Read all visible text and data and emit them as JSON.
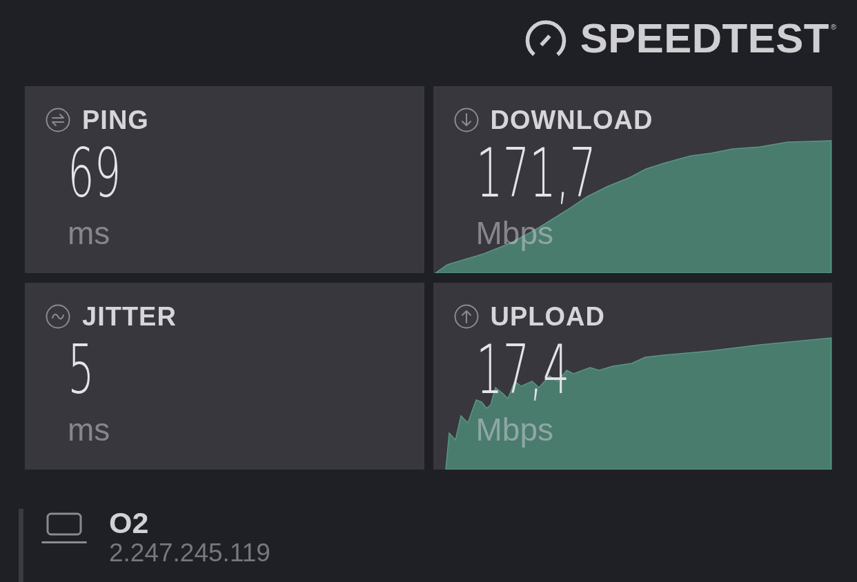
{
  "header": {
    "logo_text": "SPEEDTEST",
    "registered_mark": "®"
  },
  "results": [
    {
      "kind": "ping",
      "label": "PING",
      "value": "69",
      "unit": "ms"
    },
    {
      "kind": "download",
      "label": "DOWNLOAD",
      "value": "171,7",
      "unit": "Mbps"
    },
    {
      "kind": "jitter",
      "label": "JITTER",
      "value": "5",
      "unit": "ms"
    },
    {
      "kind": "upload",
      "label": "UPLOAD",
      "value": "17,4",
      "unit": "Mbps"
    }
  ],
  "provider": {
    "name": "O2",
    "ip": "2.247.245.119"
  }
}
